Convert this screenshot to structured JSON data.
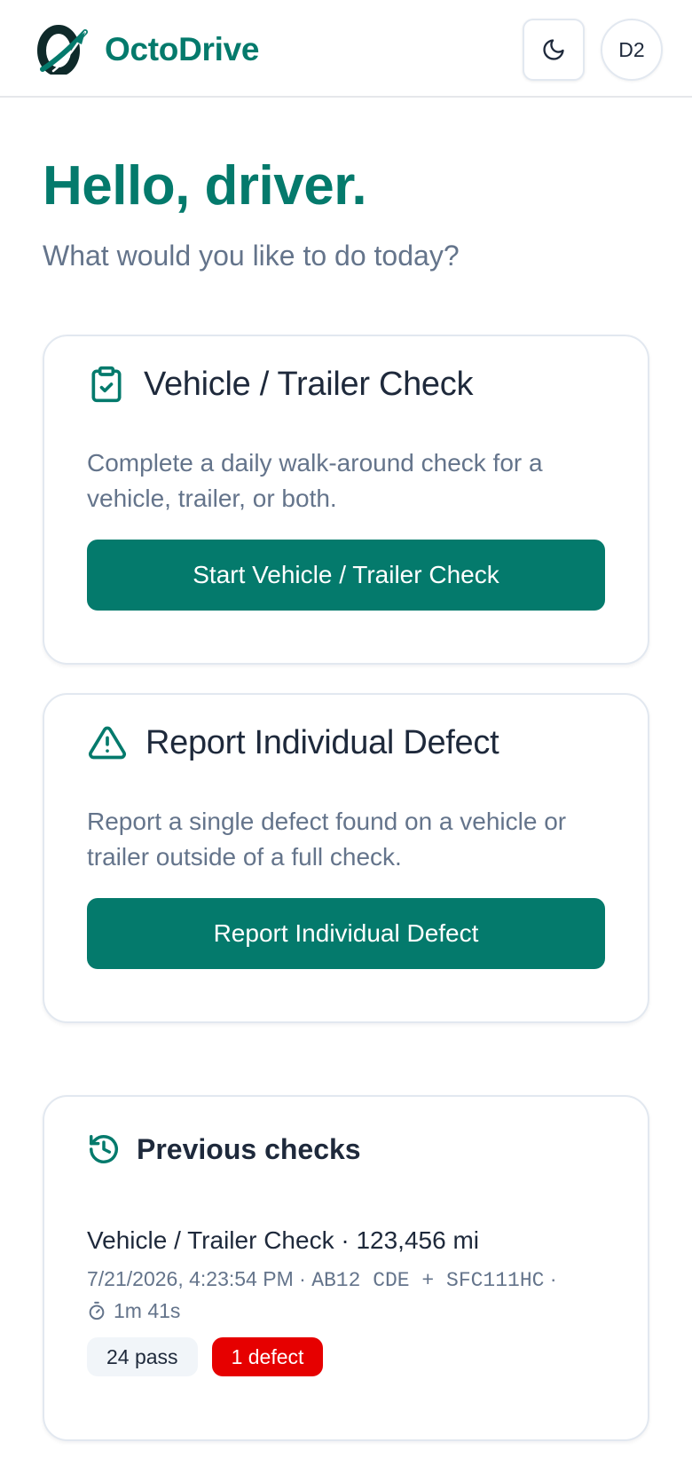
{
  "header": {
    "brand_name": "OctoDrive",
    "avatar_initials": "D2"
  },
  "greeting": {
    "title": "Hello, driver.",
    "subtitle": "What would you like to do today?"
  },
  "check_card": {
    "title": "Vehicle / Trailer Check",
    "description": "Complete a daily walk-around check for a vehicle, trailer, or both.",
    "button_label": "Start Vehicle / Trailer Check"
  },
  "defect_card": {
    "title": "Report Individual Defect",
    "description": "Report a single defect found on a vehicle or trailer outside of a full check.",
    "button_label": "Report Individual Defect"
  },
  "history": {
    "title": "Previous checks",
    "entries": [
      {
        "title": "Vehicle / Trailer Check · 123,456 mi",
        "datetime": "7/21/2026, 4:23:54 PM",
        "separator": "·",
        "registration": "AB12 CDE + SFC111HC",
        "duration": "1m 41s",
        "pass_label": "24 pass",
        "defect_label": "1 defect"
      }
    ]
  },
  "colors": {
    "brand": "#047a6c",
    "danger": "#e60000",
    "text": "#1e293b",
    "muted": "#64748b"
  },
  "icons": {
    "logo": "octodrive-logo",
    "theme": "moon-icon",
    "check": "clipboard-check-icon",
    "defect": "warning-triangle-icon",
    "history": "history-icon",
    "timer": "stopwatch-icon"
  }
}
